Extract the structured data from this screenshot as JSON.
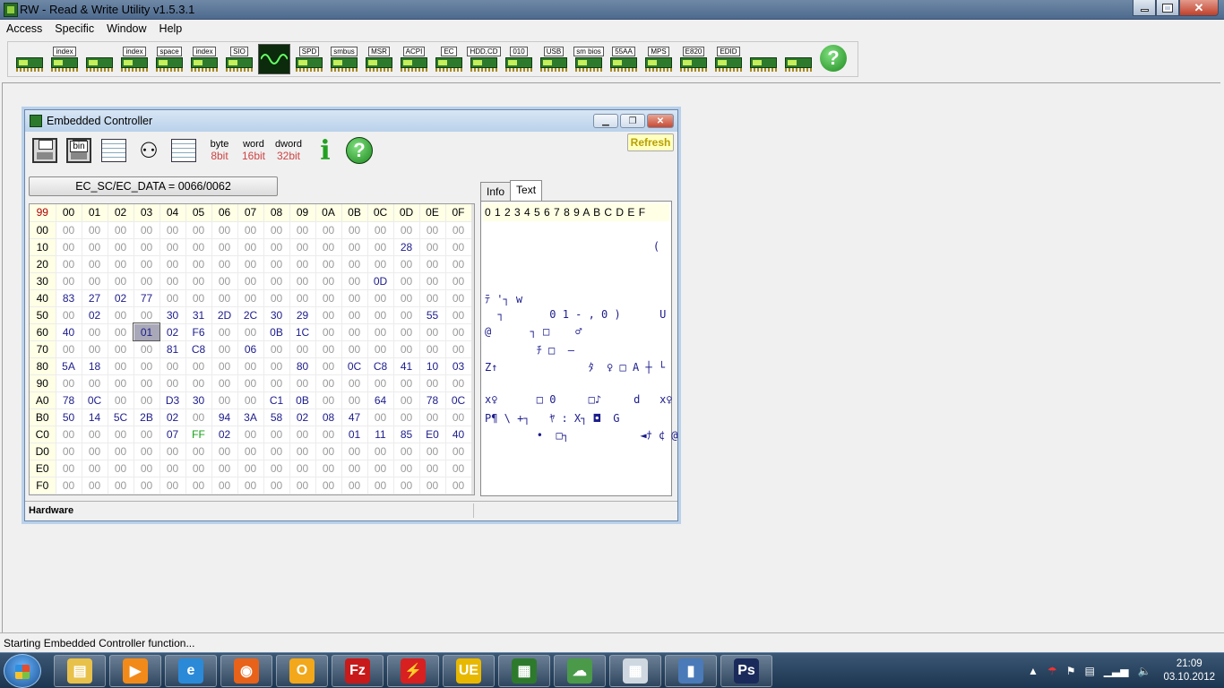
{
  "app": {
    "title": "RW - Read & Write Utility v1.5.3.1"
  },
  "menu": [
    "Access",
    "Specific",
    "Window",
    "Help"
  ],
  "toolbar": [
    {
      "name": "memory",
      "label": ""
    },
    {
      "name": "memory-index",
      "label": "index"
    },
    {
      "name": "memory-2",
      "label": ""
    },
    {
      "name": "memory-index-2",
      "label": "index"
    },
    {
      "name": "io-space",
      "label": "space"
    },
    {
      "name": "io-index",
      "label": "index"
    },
    {
      "name": "sio",
      "label": "SIO"
    },
    {
      "name": "oscilloscope",
      "label": ""
    },
    {
      "name": "spd",
      "label": "SPD"
    },
    {
      "name": "smbus",
      "label": "smbus"
    },
    {
      "name": "msr",
      "label": "MSR"
    },
    {
      "name": "acpi",
      "label": "ACPI"
    },
    {
      "name": "ec",
      "label": "EC"
    },
    {
      "name": "hdd-cd",
      "label": "HDD,CD"
    },
    {
      "name": "010",
      "label": "010"
    },
    {
      "name": "usb",
      "label": "USB"
    },
    {
      "name": "smbios",
      "label": "sm bios"
    },
    {
      "name": "55aa",
      "label": "55AA"
    },
    {
      "name": "mps",
      "label": "MPS"
    },
    {
      "name": "e820",
      "label": "E820"
    },
    {
      "name": "edid",
      "label": "EDID"
    },
    {
      "name": "command-window",
      "label": ""
    },
    {
      "name": "pci",
      "label": ""
    },
    {
      "name": "help",
      "label": "?"
    }
  ],
  "ec": {
    "title": "Embedded Controller",
    "refresh": "Refresh",
    "port_label": "EC_SC/EC_DATA = 0066/0062",
    "toolbar": {
      "bin": "bin",
      "byte_top": "byte",
      "byte_bits": "8bit",
      "word_top": "word",
      "word_bits": "16bit",
      "dword_top": "dword",
      "dword_bits": "32bit"
    },
    "corner": "99",
    "col_headers": [
      "00",
      "01",
      "02",
      "03",
      "04",
      "05",
      "06",
      "07",
      "08",
      "09",
      "0A",
      "0B",
      "0C",
      "0D",
      "0E",
      "0F"
    ],
    "rows": [
      {
        "addr": "00",
        "cells": [
          "00",
          "00",
          "00",
          "00",
          "00",
          "00",
          "00",
          "00",
          "00",
          "00",
          "00",
          "00",
          "00",
          "00",
          "00",
          "00"
        ]
      },
      {
        "addr": "10",
        "cells": [
          "00",
          "00",
          "00",
          "00",
          "00",
          "00",
          "00",
          "00",
          "00",
          "00",
          "00",
          "00",
          "00",
          "28",
          "00",
          "00"
        ]
      },
      {
        "addr": "20",
        "cells": [
          "00",
          "00",
          "00",
          "00",
          "00",
          "00",
          "00",
          "00",
          "00",
          "00",
          "00",
          "00",
          "00",
          "00",
          "00",
          "00"
        ]
      },
      {
        "addr": "30",
        "cells": [
          "00",
          "00",
          "00",
          "00",
          "00",
          "00",
          "00",
          "00",
          "00",
          "00",
          "00",
          "00",
          "0D",
          "00",
          "00",
          "00"
        ]
      },
      {
        "addr": "40",
        "cells": [
          "83",
          "27",
          "02",
          "77",
          "00",
          "00",
          "00",
          "00",
          "00",
          "00",
          "00",
          "00",
          "00",
          "00",
          "00",
          "00"
        ]
      },
      {
        "addr": "50",
        "cells": [
          "00",
          "02",
          "00",
          "00",
          "30",
          "31",
          "2D",
          "2C",
          "30",
          "29",
          "00",
          "00",
          "00",
          "00",
          "55",
          "00"
        ]
      },
      {
        "addr": "60",
        "cells": [
          "40",
          "00",
          "00",
          "01",
          "02",
          "F6",
          "00",
          "00",
          "0B",
          "1C",
          "00",
          "00",
          "00",
          "00",
          "00",
          "00"
        ]
      },
      {
        "addr": "70",
        "cells": [
          "00",
          "00",
          "00",
          "00",
          "81",
          "C8",
          "00",
          "06",
          "00",
          "00",
          "00",
          "00",
          "00",
          "00",
          "00",
          "00"
        ]
      },
      {
        "addr": "80",
        "cells": [
          "5A",
          "18",
          "00",
          "00",
          "00",
          "00",
          "00",
          "00",
          "00",
          "80",
          "00",
          "0C",
          "C8",
          "41",
          "10",
          "03"
        ]
      },
      {
        "addr": "90",
        "cells": [
          "00",
          "00",
          "00",
          "00",
          "00",
          "00",
          "00",
          "00",
          "00",
          "00",
          "00",
          "00",
          "00",
          "00",
          "00",
          "00"
        ]
      },
      {
        "addr": "A0",
        "cells": [
          "78",
          "0C",
          "00",
          "00",
          "D3",
          "30",
          "00",
          "00",
          "C1",
          "0B",
          "00",
          "00",
          "64",
          "00",
          "78",
          "0C"
        ]
      },
      {
        "addr": "B0",
        "cells": [
          "50",
          "14",
          "5C",
          "2B",
          "02",
          "00",
          "94",
          "3A",
          "58",
          "02",
          "08",
          "47",
          "00",
          "00",
          "00",
          "00"
        ]
      },
      {
        "addr": "C0",
        "cells": [
          "00",
          "00",
          "00",
          "00",
          "07",
          "FF",
          "02",
          "00",
          "00",
          "00",
          "00",
          "01",
          "11",
          "85",
          "E0",
          "40"
        ]
      },
      {
        "addr": "D0",
        "cells": [
          "00",
          "00",
          "00",
          "00",
          "00",
          "00",
          "00",
          "00",
          "00",
          "00",
          "00",
          "00",
          "00",
          "00",
          "00",
          "00"
        ]
      },
      {
        "addr": "E0",
        "cells": [
          "00",
          "00",
          "00",
          "00",
          "00",
          "00",
          "00",
          "00",
          "00",
          "00",
          "00",
          "00",
          "00",
          "00",
          "00",
          "00"
        ]
      },
      {
        "addr": "F0",
        "cells": [
          "00",
          "00",
          "00",
          "00",
          "00",
          "00",
          "00",
          "00",
          "00",
          "00",
          "00",
          "00",
          "00",
          "00",
          "00",
          "00"
        ]
      }
    ],
    "selected": {
      "row": 6,
      "col": 3
    },
    "tabs": [
      "Info",
      "Text"
    ],
    "active_tab": "Text",
    "text_header": "0 1 2 3 4 5 6 7 8 9 A B C D E F",
    "text_lines": [
      {
        "row": 0,
        "text": ""
      },
      {
        "row": 1,
        "text": "                          ("
      },
      {
        "row": 2,
        "text": ""
      },
      {
        "row": 3,
        "text": ""
      },
      {
        "row": 4,
        "text": "ﾃ '┐ w"
      },
      {
        "row": 5,
        "text": "  ┐       0 1 - , 0 )      U"
      },
      {
        "row": 6,
        "text": "@      ┐ □    ♂"
      },
      {
        "row": 7,
        "text": "        ﾁ □  –"
      },
      {
        "row": 8,
        "text": "Z↑              ﾀ  ♀ □ A ┼ └"
      },
      {
        "row": 9,
        "text": ""
      },
      {
        "row": 10,
        "text": "x♀      □ 0     □♪     d   x♀"
      },
      {
        "row": 11,
        "text": "P¶ \\ +┐   ﾔ : X┐ ◘  G"
      },
      {
        "row": 12,
        "text": "        •  □┐           ◄ﾅ ¢ @"
      },
      {
        "row": 13,
        "text": ""
      },
      {
        "row": 14,
        "text": ""
      },
      {
        "row": 15,
        "text": ""
      }
    ],
    "status": "Hardware"
  },
  "statusbar": "Starting Embedded Controller function...",
  "taskbar": {
    "apps": [
      "explorer",
      "media",
      "ie",
      "firefox",
      "outlook",
      "filezilla",
      "flashget",
      "ultraedit",
      "rw",
      "network",
      "calculator",
      "paint",
      "photoshop"
    ],
    "time": "21:09",
    "date": "03.10.2012"
  },
  "colors": {
    "value_nonzero": "#1c1c8c",
    "value_zero": "#9a9a9a",
    "value_ff": "#12a012",
    "header_bg": "#ffffe6"
  }
}
